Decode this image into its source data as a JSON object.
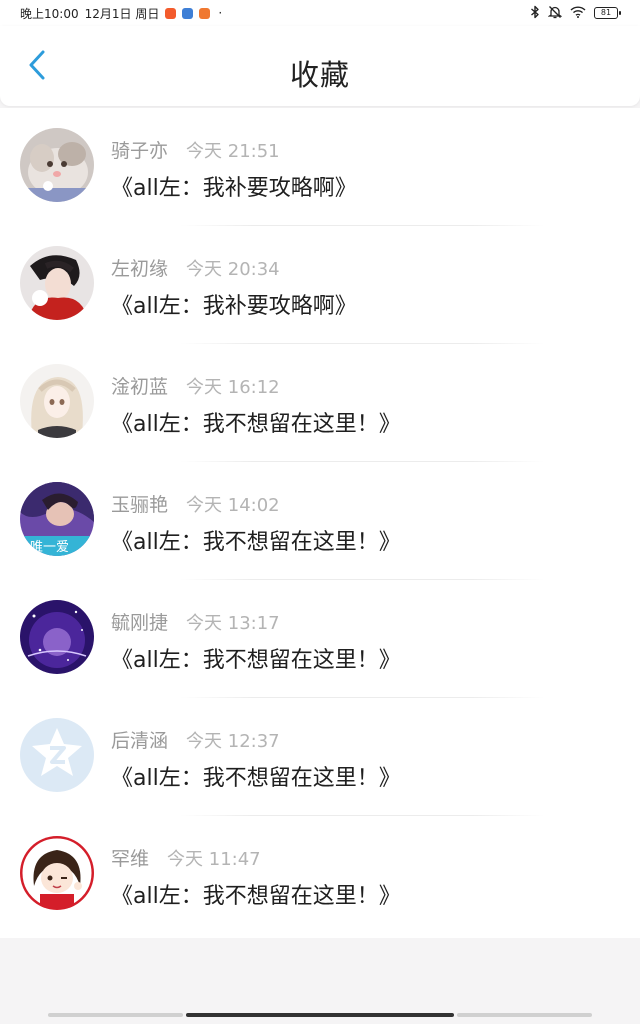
{
  "status_bar": {
    "time": "晚上10:00",
    "date": "12月1日 周日",
    "dot": "·",
    "battery": "81",
    "icons": [
      "bluetooth-icon",
      "mute-icon",
      "wifi-icon",
      "battery-icon"
    ]
  },
  "nav": {
    "title": "收藏",
    "back_icon": "chevron-left-icon",
    "accent_color": "#2d9cdb"
  },
  "items": [
    {
      "name": "骑子亦",
      "time": "今天 21:51",
      "message": "《all左：我补要攻略啊》"
    },
    {
      "name": "左初缘",
      "time": "今天 20:34",
      "message": "《all左：我补要攻略啊》"
    },
    {
      "name": "淦初蓝",
      "time": "今天 16:12",
      "message": "《all左：我不想留在这里！》"
    },
    {
      "name": "玉骊艳",
      "time": "今天 14:02",
      "message": "《all左：我不想留在这里！》",
      "avatar_caption": "唯一爱"
    },
    {
      "name": "毓刚捷",
      "time": "今天 13:17",
      "message": "《all左：我不想留在这里！》"
    },
    {
      "name": "后清涵",
      "time": "今天 12:37",
      "message": "《all左：我不想留在这里！》"
    },
    {
      "name": "罕维",
      "time": "今天 11:47",
      "message": "《all左：我不想留在这里！》"
    }
  ]
}
